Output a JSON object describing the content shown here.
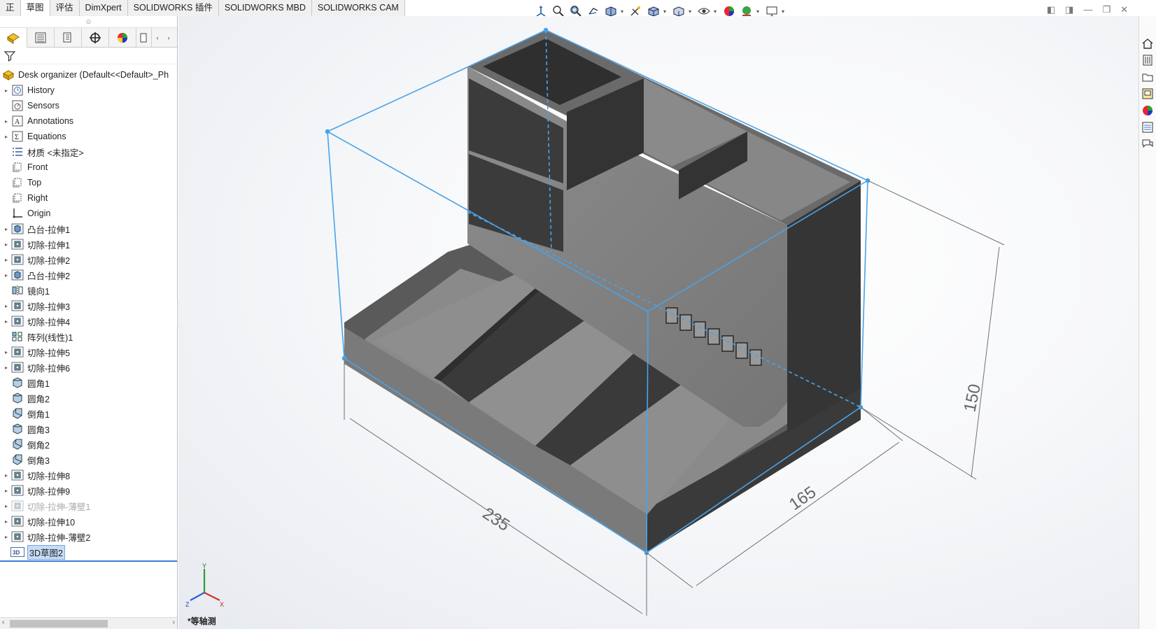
{
  "tabs": [
    "正",
    "草图",
    "评估",
    "DimXpert",
    "SOLIDWORKS 插件",
    "SOLIDWORKS MBD",
    "SOLIDWORKS CAM"
  ],
  "active_tab_index": 1,
  "view_toolbar": {
    "icons": [
      "view-orientation-icon",
      "zoom-to-fit-icon",
      "zoom-area-icon",
      "previous-view-icon",
      "section-view-icon",
      "dynamic-annotation-icon",
      "view-orientation-cube-icon",
      "display-style-icon",
      "hide-show-items-icon",
      "edit-appearance-icon",
      "apply-scene-icon",
      "view-settings-icon"
    ]
  },
  "panel_tabs": [
    "featuremanager-icon",
    "propertymanager-icon",
    "configurationmanager-icon",
    "dimxpert-manager-icon",
    "display-manager-icon",
    "more-tabs-icon"
  ],
  "tree": {
    "root": {
      "label": "Desk organizer  (Default<<Default>_Ph",
      "icon": "part-icon"
    },
    "items": [
      {
        "label": "History",
        "icon": "history-icon",
        "arrow": true,
        "dim": false
      },
      {
        "label": "Sensors",
        "icon": "sensors-icon",
        "arrow": false,
        "dim": false
      },
      {
        "label": "Annotations",
        "icon": "annotations-icon",
        "arrow": true,
        "dim": false
      },
      {
        "label": "Equations",
        "icon": "equations-icon",
        "arrow": true,
        "dim": false
      },
      {
        "label": "材质 <未指定>",
        "icon": "material-icon",
        "arrow": false,
        "dim": false
      },
      {
        "label": "Front",
        "icon": "plane-icon",
        "arrow": false,
        "dim": false
      },
      {
        "label": "Top",
        "icon": "plane-icon",
        "arrow": false,
        "dim": false
      },
      {
        "label": "Right",
        "icon": "plane-icon",
        "arrow": false,
        "dim": false
      },
      {
        "label": "Origin",
        "icon": "origin-icon",
        "arrow": false,
        "dim": false
      },
      {
        "label": "凸台-拉伸1",
        "icon": "boss-extrude-icon",
        "arrow": true,
        "dim": false
      },
      {
        "label": "切除-拉伸1",
        "icon": "cut-extrude-icon",
        "arrow": true,
        "dim": false
      },
      {
        "label": "切除-拉伸2",
        "icon": "cut-extrude-icon",
        "arrow": true,
        "dim": false
      },
      {
        "label": "凸台-拉伸2",
        "icon": "boss-extrude-icon",
        "arrow": true,
        "dim": false
      },
      {
        "label": "镜向1",
        "icon": "mirror-icon",
        "arrow": false,
        "dim": false
      },
      {
        "label": "切除-拉伸3",
        "icon": "cut-extrude-icon",
        "arrow": true,
        "dim": false
      },
      {
        "label": "切除-拉伸4",
        "icon": "cut-extrude-icon",
        "arrow": true,
        "dim": false
      },
      {
        "label": "阵列(线性)1",
        "icon": "linear-pattern-icon",
        "arrow": false,
        "dim": false
      },
      {
        "label": "切除-拉伸5",
        "icon": "cut-extrude-icon",
        "arrow": true,
        "dim": false
      },
      {
        "label": "切除-拉伸6",
        "icon": "cut-extrude-icon",
        "arrow": true,
        "dim": false
      },
      {
        "label": "圆角1",
        "icon": "fillet-icon",
        "arrow": false,
        "dim": false
      },
      {
        "label": "圆角2",
        "icon": "fillet-icon",
        "arrow": false,
        "dim": false
      },
      {
        "label": "倒角1",
        "icon": "chamfer-icon",
        "arrow": false,
        "dim": false
      },
      {
        "label": "圆角3",
        "icon": "fillet-icon",
        "arrow": false,
        "dim": false
      },
      {
        "label": "倒角2",
        "icon": "chamfer-icon",
        "arrow": false,
        "dim": false
      },
      {
        "label": "倒角3",
        "icon": "chamfer-icon",
        "arrow": false,
        "dim": false
      },
      {
        "label": "切除-拉伸8",
        "icon": "cut-extrude-icon",
        "arrow": true,
        "dim": false
      },
      {
        "label": "切除-拉伸9",
        "icon": "cut-extrude-icon",
        "arrow": true,
        "dim": false
      },
      {
        "label": "切除-拉伸-薄壁1",
        "icon": "cut-extrude-icon",
        "arrow": true,
        "dim": true
      },
      {
        "label": "切除-拉伸10",
        "icon": "cut-extrude-icon",
        "arrow": true,
        "dim": false
      },
      {
        "label": "切除-拉伸-薄壁2",
        "icon": "cut-extrude-icon",
        "arrow": true,
        "dim": false
      },
      {
        "label": "3D草图2",
        "icon": "3d-sketch-icon",
        "arrow": false,
        "dim": false,
        "selected": true
      }
    ]
  },
  "dimensions": {
    "width": "235",
    "depth": "165",
    "height": "150"
  },
  "triad": {
    "x": "X",
    "y": "Y",
    "z": "Z"
  },
  "view_name": "*等轴测",
  "task_pane": [
    "home-icon",
    "design-library-icon",
    "file-explorer-icon",
    "view-palette-icon",
    "appearances-icon",
    "custom-properties-icon",
    "forum-icon"
  ],
  "colors": {
    "accent": "#3a8ee6",
    "solid_face": "#7c7c7c",
    "dark_face": "#3a3a3a",
    "selection_blue": "#4aa3e8"
  }
}
